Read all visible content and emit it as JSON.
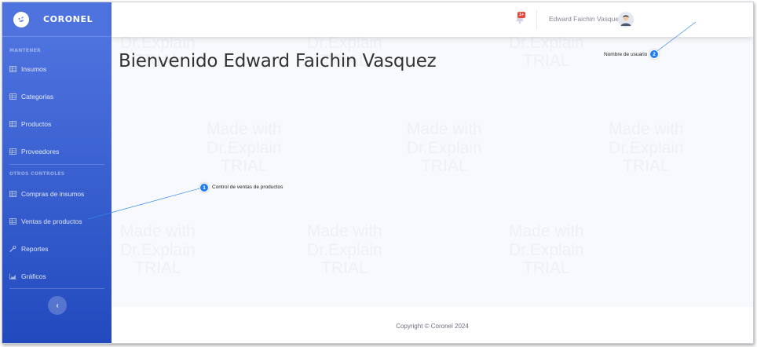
{
  "brand": {
    "name": "CORONEL",
    "logo_icon": "laugh-wink-icon"
  },
  "sidebar": {
    "sections": [
      {
        "label": "MANTENER"
      },
      {
        "label": "OTROS CONTROLES"
      }
    ],
    "items": [
      {
        "label": "Insumos",
        "icon": "table-icon"
      },
      {
        "label": "Categorias",
        "icon": "table-icon"
      },
      {
        "label": "Productos",
        "icon": "table-icon"
      },
      {
        "label": "Proveedores",
        "icon": "table-icon"
      },
      {
        "label": "Compras de insumos",
        "icon": "table-icon"
      },
      {
        "label": "Ventas de productos",
        "icon": "table-icon"
      },
      {
        "label": "Reportes",
        "icon": "wrench-icon"
      },
      {
        "label": "Gráficos",
        "icon": "chart-area-icon"
      }
    ],
    "toggle_label": "‹"
  },
  "topbar": {
    "alerts_badge": "1+",
    "user_name": "Edward Faichin Vasquez"
  },
  "main": {
    "heading": "Bienvenido Edward Faichin Vasquez"
  },
  "footer": {
    "copyright": "Copyright © Coronel 2024"
  },
  "annotations": [
    {
      "number": "1",
      "text": "Control de ventas de productos"
    },
    {
      "number": "2",
      "text": "Nombre de usuario"
    }
  ],
  "watermark": "Made with\nDr.Explain\nTRIAL",
  "colors": {
    "sidebar_top": "#4e73df",
    "sidebar_bottom": "#224abe",
    "marker": "#1e7bf0",
    "badge": "#e74a3b"
  }
}
